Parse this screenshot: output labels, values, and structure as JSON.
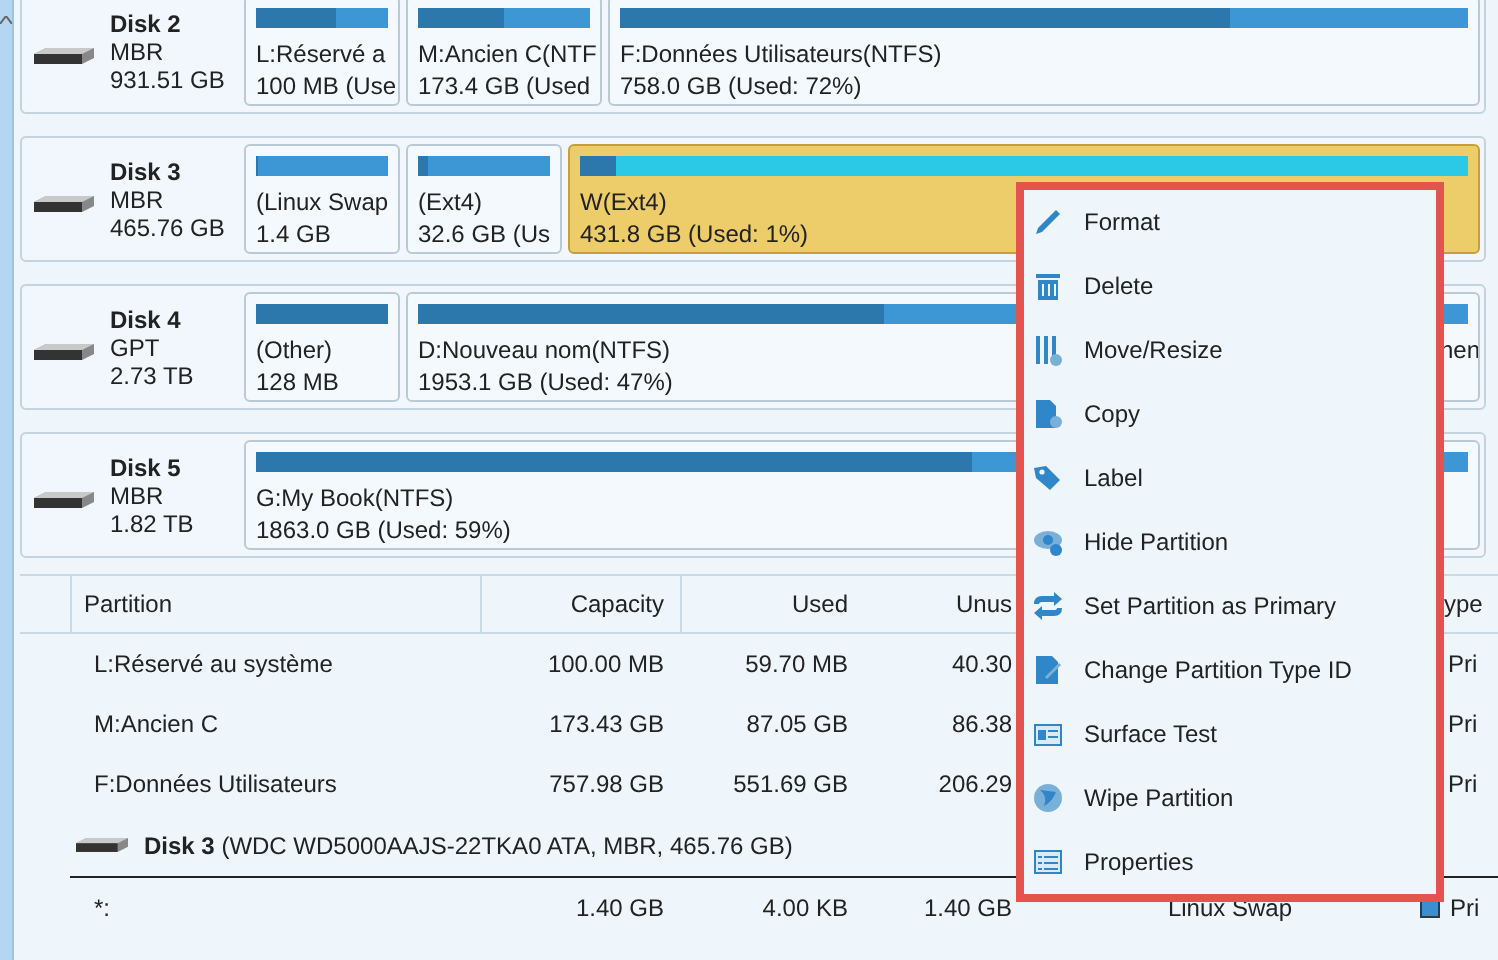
{
  "disks": [
    {
      "name": "Disk 2",
      "scheme": "MBR",
      "size": "931.51 GB",
      "partitions": [
        {
          "name": "L:Réservé a",
          "usage": "100 MB (Use",
          "level": 0.6,
          "selected": false
        },
        {
          "name": "M:Ancien C(NTF",
          "usage": "173.4 GB (Used",
          "level": 0.5,
          "selected": false
        },
        {
          "name": "F:Données Utilisateurs(NTFS)",
          "usage": "758.0 GB (Used: 72%)",
          "level": 0.72,
          "selected": false
        }
      ]
    },
    {
      "name": "Disk 3",
      "scheme": "MBR",
      "size": "465.76 GB",
      "partitions": [
        {
          "name": "(Linux Swap",
          "usage": "1.4 GB",
          "level": 0,
          "selected": false
        },
        {
          "name": "(Ext4)",
          "usage": "32.6 GB (Us",
          "level": 0.08,
          "selected": false
        },
        {
          "name": "W(Ext4)",
          "usage": "431.8 GB (Used: 1%)",
          "level": 0.04,
          "selected": true
        }
      ]
    },
    {
      "name": "Disk 4",
      "scheme": "GPT",
      "size": "2.73 TB",
      "partitions": [
        {
          "name": "(Other)",
          "usage": "128 MB",
          "level": 1,
          "selected": false
        },
        {
          "name": "D:Nouveau nom(NTFS)",
          "usage": "1953.1 GB (Used: 47%)",
          "level": 0.47,
          "selected": false
        },
        {
          "name": "nen",
          "selected": false
        }
      ]
    },
    {
      "name": "Disk 5",
      "scheme": "MBR",
      "size": "1.82 TB",
      "partitions": [
        {
          "name": "G:My Book(NTFS)",
          "usage": "1863.0 GB (Used: 59%)",
          "level": 0.59,
          "selected": false
        }
      ]
    }
  ],
  "table": {
    "columns": [
      "Partition",
      "Capacity",
      "Used",
      "Unus",
      "",
      "ype"
    ],
    "rows": [
      {
        "kind": "partition",
        "cells": [
          "L:Réservé au système",
          "100.00 MB",
          "59.70 MB",
          "40.30",
          "",
          "Pri"
        ]
      },
      {
        "kind": "partition",
        "cells": [
          "M:Ancien C",
          "173.43 GB",
          "87.05 GB",
          "86.38",
          "",
          "Pri"
        ]
      },
      {
        "kind": "partition",
        "cells": [
          "F:Données Utilisateurs",
          "757.98 GB",
          "551.69 GB",
          "206.29",
          "",
          "Pri"
        ]
      },
      {
        "kind": "disk",
        "text": "**Disk 3** (WDC WD5000AAJS-22TKA0 ATA, MBR, 465.76 GB)"
      },
      {
        "kind": "partition",
        "cells": [
          "*:",
          "1.40 GB",
          "4.00 KB",
          "1.40 GB",
          "Linux Swap",
          "Pri"
        ],
        "color": "#3a8fd0"
      }
    ]
  },
  "context_menu": [
    "Format",
    "Delete",
    "Move/Resize",
    "Copy",
    "Label",
    "Hide Partition",
    "Set Partition as Primary",
    "Change Partition Type ID",
    "Surface Test",
    "Wipe Partition",
    "Properties"
  ]
}
